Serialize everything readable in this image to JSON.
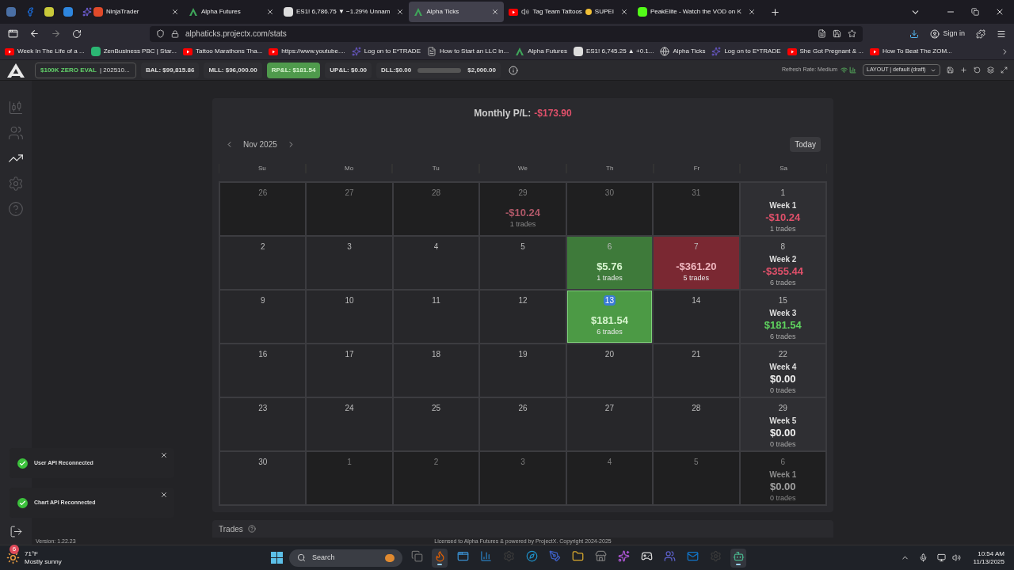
{
  "browser": {
    "pinned_tabs": [
      {
        "kind": "chart"
      },
      {
        "kind": "facebook"
      },
      {
        "kind": "chat"
      },
      {
        "kind": "trade"
      },
      {
        "kind": "star"
      }
    ],
    "tabs": [
      {
        "title": "NinjaTrader",
        "kind": "ninja",
        "selected": false,
        "audio": false
      },
      {
        "title": "Alpha Futures",
        "kind": "alpha",
        "selected": false,
        "audio": false
      },
      {
        "title": "ES1! 6,786.75 ▼ −1.29% Unnam",
        "kind": "tv",
        "selected": false,
        "audio": false
      },
      {
        "title": "Alpha Ticks",
        "kind": "alpha",
        "selected": true,
        "audio": false
      },
      {
        "title": "Tag Team Tattoos",
        "title_end": "SUPEI",
        "kind": "youtube",
        "selected": false,
        "audio": true
      },
      {
        "title": "PeakElite - Watch the VOD on K",
        "kind": "kick",
        "selected": false,
        "audio": false
      }
    ],
    "url": "alphaticks.projectx.com/stats",
    "sign_in": "Sign in",
    "bookmarks": [
      {
        "label": "Week In The Life of a ...",
        "kind": "youtube"
      },
      {
        "label": "ZenBusiness PBC | Star...",
        "kind": "zen"
      },
      {
        "label": "Tattoo Marathons Tha...",
        "kind": "youtube"
      },
      {
        "label": "https://www.youtube....",
        "kind": "youtube"
      },
      {
        "label": "Log on to E*TRADE",
        "kind": "etrade"
      },
      {
        "label": "How to Start an LLC in...",
        "kind": "doc"
      },
      {
        "label": "Alpha Futures",
        "kind": "alpha"
      },
      {
        "label": "ES1! 6,745.25 ▲ +0.1...",
        "kind": "tv"
      },
      {
        "label": "Alpha Ticks",
        "kind": "globe"
      },
      {
        "label": "Log on to E*TRADE",
        "kind": "etrade"
      },
      {
        "label": "She Got Pregnant & ...",
        "kind": "youtube"
      },
      {
        "label": "How To Beat The ZOM...",
        "kind": "youtube"
      }
    ]
  },
  "header": {
    "account": "$100K ZERO EVAL",
    "account_id": "| 202510...",
    "stats": [
      {
        "text": "BAL: $99,815.86",
        "highlight": false
      },
      {
        "text": "MLL: $96,000.00",
        "highlight": false
      },
      {
        "text": "RP&L: $181.54",
        "highlight": true
      },
      {
        "text": "UP&L: $0.00",
        "highlight": false
      }
    ],
    "dll": {
      "label": "DLL:$0.00",
      "limit": "$2,000.00"
    },
    "refresh": "Refresh Rate: Medium",
    "layout": "LAYOUT | default (draft)"
  },
  "sidebar": [
    {
      "kind": "chart",
      "selected": false
    },
    {
      "kind": "users",
      "selected": false
    },
    {
      "kind": "stats",
      "selected": true
    },
    {
      "kind": "settings",
      "selected": false
    },
    {
      "kind": "help",
      "selected": false
    }
  ],
  "calendar": {
    "title": "Monthly P/L:",
    "total": "-$173.90",
    "month": "Nov 2025",
    "today_button": "Today",
    "weekdays": [
      "Su",
      "Mo",
      "Tu",
      "We",
      "Th",
      "Fr",
      "Sa"
    ],
    "cells": [
      {
        "day": "26",
        "outside": true,
        "today": false,
        "kind": "plain"
      },
      {
        "day": "27",
        "outside": true,
        "today": false,
        "kind": "plain"
      },
      {
        "day": "28",
        "outside": true,
        "today": false,
        "kind": "plain"
      },
      {
        "day": "29",
        "outside": true,
        "today": false,
        "kind": "plain",
        "pnl": "-$10.24",
        "color": "#b05868",
        "trades": "1 trades"
      },
      {
        "day": "30",
        "outside": true,
        "today": false,
        "kind": "plain"
      },
      {
        "day": "31",
        "outside": true,
        "today": false,
        "kind": "plain"
      },
      {
        "day": "1",
        "outside": false,
        "today": false,
        "kind": "plain",
        "label": "Week 1",
        "pnl": "-$10.24",
        "color": "#e0506a",
        "trades": "1 trades"
      },
      {
        "day": "2",
        "outside": false,
        "today": false,
        "kind": "plain"
      },
      {
        "day": "3",
        "outside": false,
        "today": false,
        "kind": "plain"
      },
      {
        "day": "4",
        "outside": false,
        "today": false,
        "kind": "plain"
      },
      {
        "day": "5",
        "outside": false,
        "today": false,
        "kind": "plain"
      },
      {
        "day": "6",
        "outside": false,
        "today": false,
        "kind": "gain",
        "pnl": "$5.76",
        "color": "#d8f5d0",
        "trades": "1 trades"
      },
      {
        "day": "7",
        "outside": false,
        "today": false,
        "kind": "loss",
        "pnl": "-$361.20",
        "color": "#f0b8c0",
        "trades": "5 trades"
      },
      {
        "day": "8",
        "outside": false,
        "today": false,
        "kind": "plain",
        "label": "Week 2",
        "pnl": "-$355.44",
        "color": "#e0506a",
        "trades": "6 trades"
      },
      {
        "day": "9",
        "outside": false,
        "today": false,
        "kind": "plain"
      },
      {
        "day": "10",
        "outside": false,
        "today": false,
        "kind": "plain"
      },
      {
        "day": "11",
        "outside": false,
        "today": false,
        "kind": "plain"
      },
      {
        "day": "12",
        "outside": false,
        "today": false,
        "kind": "plain"
      },
      {
        "day": "13",
        "outside": false,
        "today": true,
        "kind": "gain",
        "pnl": "$181.54",
        "color": "#d8f5d0",
        "trades": "6 trades"
      },
      {
        "day": "14",
        "outside": false,
        "today": false,
        "kind": "plain"
      },
      {
        "day": "15",
        "outside": false,
        "today": false,
        "kind": "plain",
        "label": "Week 3",
        "pnl": "$181.54",
        "color": "#5fd35f",
        "trades": "6 trades"
      },
      {
        "day": "16",
        "outside": false,
        "today": false,
        "kind": "plain"
      },
      {
        "day": "17",
        "outside": false,
        "today": false,
        "kind": "plain"
      },
      {
        "day": "18",
        "outside": false,
        "today": false,
        "kind": "plain"
      },
      {
        "day": "19",
        "outside": false,
        "today": false,
        "kind": "plain"
      },
      {
        "day": "20",
        "outside": false,
        "today": false,
        "kind": "plain"
      },
      {
        "day": "21",
        "outside": false,
        "today": false,
        "kind": "plain"
      },
      {
        "day": "22",
        "outside": false,
        "today": false,
        "kind": "plain",
        "label": "Week 4",
        "pnl": "$0.00",
        "color": "#f0f0f0",
        "trades": "0 trades"
      },
      {
        "day": "23",
        "outside": false,
        "today": false,
        "kind": "plain"
      },
      {
        "day": "24",
        "outside": false,
        "today": false,
        "kind": "plain"
      },
      {
        "day": "25",
        "outside": false,
        "today": false,
        "kind": "plain"
      },
      {
        "day": "26",
        "outside": false,
        "today": false,
        "kind": "plain"
      },
      {
        "day": "27",
        "outside": false,
        "today": false,
        "kind": "plain"
      },
      {
        "day": "28",
        "outside": false,
        "today": false,
        "kind": "plain"
      },
      {
        "day": "29",
        "outside": false,
        "today": false,
        "kind": "plain",
        "label": "Week 5",
        "pnl": "$0.00",
        "color": "#f0f0f0",
        "trades": "0 trades"
      },
      {
        "day": "30",
        "outside": false,
        "today": false,
        "kind": "plain"
      },
      {
        "day": "1",
        "outside": true,
        "today": false,
        "kind": "plain"
      },
      {
        "day": "2",
        "outside": true,
        "today": false,
        "kind": "plain"
      },
      {
        "day": "3",
        "outside": true,
        "today": false,
        "kind": "plain"
      },
      {
        "day": "4",
        "outside": true,
        "today": false,
        "kind": "plain"
      },
      {
        "day": "5",
        "outside": true,
        "today": false,
        "kind": "plain"
      },
      {
        "day": "6",
        "outside": true,
        "today": false,
        "kind": "plain",
        "label": "Week 1",
        "pnl": "$0.00",
        "color": "#a0a0a0",
        "trades": "0 trades"
      }
    ]
  },
  "trades": {
    "title": "Trades"
  },
  "toasts": [
    {
      "text": "User API Reconnected"
    },
    {
      "text": "Chart API Reconnected"
    }
  ],
  "footer": {
    "version": "Version: 1.22.23",
    "license": "Licensed to Alpha Futures & powered by ProjectX. Copyright 2024-2025"
  },
  "taskbar": {
    "temperature": "71°F",
    "weather": "Mostly sunny",
    "badge": "6",
    "search": "Search",
    "apps": [
      {
        "kind": "taskview",
        "active": false
      },
      {
        "kind": "firefox",
        "active": true
      },
      {
        "kind": "window",
        "active": false
      },
      {
        "kind": "chart",
        "active": false
      },
      {
        "kind": "steel",
        "active": false
      },
      {
        "kind": "edge",
        "active": false
      },
      {
        "kind": "pen",
        "active": false
      },
      {
        "kind": "folder",
        "active": false
      },
      {
        "kind": "store",
        "active": false
      },
      {
        "kind": "copilot",
        "active": false
      },
      {
        "kind": "dark",
        "active": false
      },
      {
        "kind": "teams",
        "active": false
      },
      {
        "kind": "outlook",
        "active": false
      },
      {
        "kind": "steel",
        "active": false
      },
      {
        "kind": "bot",
        "active": true
      }
    ],
    "time": "10:54 AM",
    "date": "11/13/2025"
  }
}
